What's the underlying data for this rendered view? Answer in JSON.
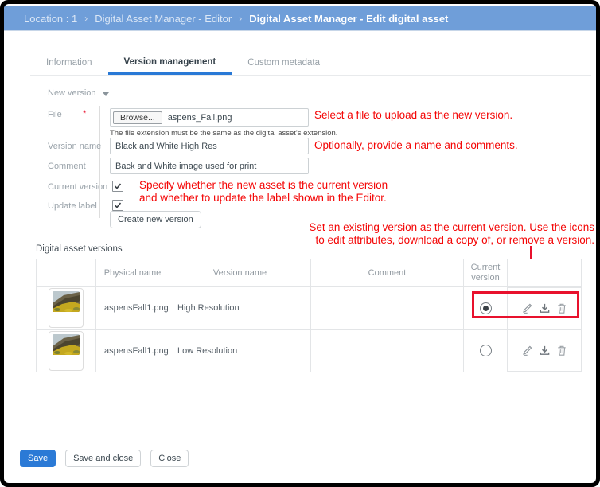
{
  "breadcrumb": {
    "items": [
      "Location : 1",
      "Digital Asset Manager - Editor"
    ],
    "current": "Digital Asset Manager - Edit digital asset",
    "separator": "›"
  },
  "tabs": [
    {
      "label": "Information"
    },
    {
      "label": "Version management"
    },
    {
      "label": "Custom metadata"
    }
  ],
  "form": {
    "section_label": "New version",
    "file": {
      "label": "File",
      "required_marker": "*",
      "browse_label": "Browse...",
      "filename": "aspens_Fall.png",
      "helper": "The file extension must be the same as the digital asset's extension."
    },
    "version_name": {
      "label": "Version name",
      "value": "Black and White High Res"
    },
    "comment": {
      "label": "Comment",
      "value": "Back and White image used for print"
    },
    "current_version": {
      "label": "Current version",
      "checked": true
    },
    "update_label": {
      "label": "Update label",
      "checked": true
    },
    "create_button_label": "Create new version"
  },
  "annotations": {
    "file_note": "Select a file to upload as the new version.",
    "name_note": "Optionally, provide a name and comments.",
    "checkbox_note_line1": "Specify whether the new asset is the current version",
    "checkbox_note_line2": "and whether to update the label shown in the Editor.",
    "table_note_line1": "Set an existing version as the current version. Use the icons",
    "table_note_line2": "to edit attributes, download a copy of, or remove a version.",
    "text_color": "#f40505",
    "shape_color": "#e8112d"
  },
  "versions_table": {
    "title": "Digital asset versions",
    "columns": {
      "thumbnail": "",
      "physical_name": "Physical name",
      "version_name": "Version name",
      "comment": "Comment",
      "current_version": "Current version",
      "actions": ""
    },
    "rows": [
      {
        "physical_name": "aspensFall1.png",
        "version_name": "High Resolution",
        "comment": "",
        "current": true
      },
      {
        "physical_name": "aspensFall1.png",
        "version_name": "Low Resolution",
        "comment": "",
        "current": false
      }
    ],
    "row_action_icons": [
      "edit-icon",
      "download-icon",
      "delete-icon"
    ]
  },
  "footer": {
    "save_label": "Save",
    "save_and_close_label": "Save and close",
    "close_label": "Close"
  },
  "colors": {
    "header_bg": "#6f9ed9",
    "tab_underline": "#2979d6",
    "save_button_bg": "#2b7ad6"
  }
}
